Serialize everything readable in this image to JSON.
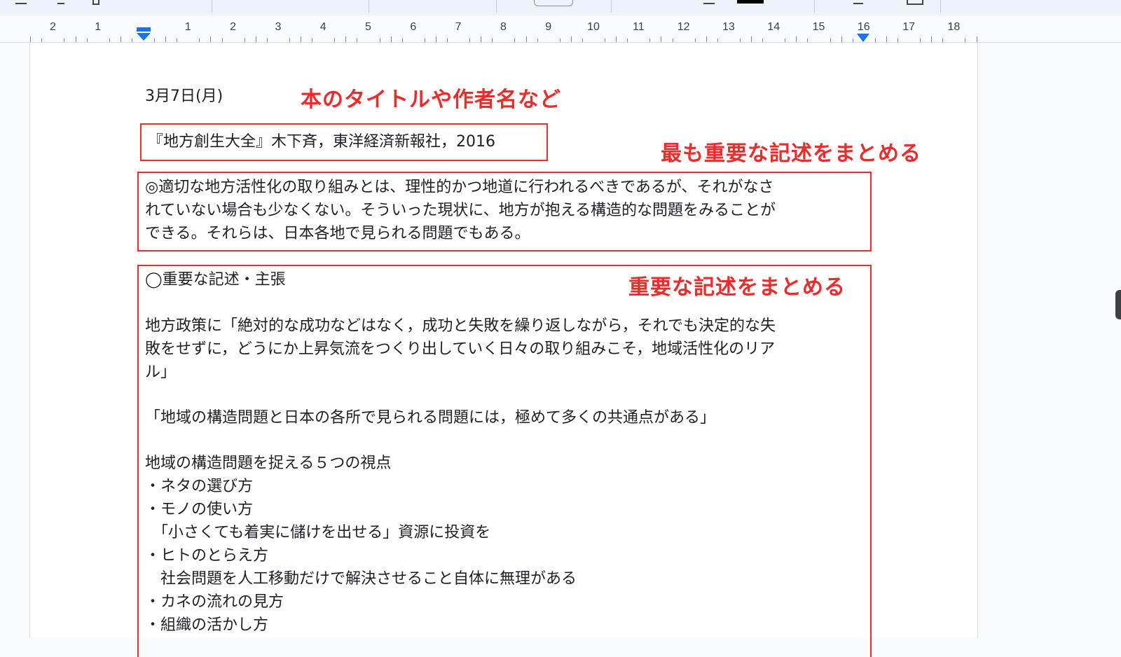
{
  "colors": {
    "annotation": "#ee2a2a",
    "indent_marker": "#1a73e8"
  },
  "ruler": {
    "numbers": [
      "2",
      "1",
      "1",
      "2",
      "3",
      "4",
      "5",
      "6",
      "7",
      "8",
      "9",
      "10",
      "11",
      "12",
      "13",
      "14",
      "15",
      "16",
      "17",
      "18"
    ],
    "icons": [
      "first-line-indent-icon",
      "right-indent-icon"
    ]
  },
  "document": {
    "date": "3月7日(月)",
    "citation": "『地方創生大全』木下斉，東洋経済新報社，2016",
    "summary_lines": [
      "◎適切な地方活性化の取り組みとは、理性的かつ地道に行われるべきであるが、それがなさ",
      "れていない場合も少なくない。そういった現状に、地方が抱える構造的な問題をみることが",
      "できる。それらは、日本各地で見られる問題でもある。"
    ],
    "section_heading": "◯重要な記述・主張",
    "quote1_lines": [
      "地方政策に「絶対的な成功などはなく，成功と失敗を繰り返しながら，それでも決定的な失",
      "敗をせずに，どうにか上昇気流をつくり出していく日々の取り組みこそ，地域活性化のリア",
      "ル」"
    ],
    "quote2": "「地域の構造問題と日本の各所で見られる問題には，極めて多くの共通点がある」",
    "viewpoints_title": "地域の構造問題を捉える５つの視点",
    "viewpoints": [
      "・ネタの選び方",
      "・モノの使い方",
      "　「小さくても着実に儲けを出せる」資源に投資を",
      "・ヒトのとらえ方",
      "　社会問題を人工移動だけで解決させること自体に無理がある",
      "・カネの流れの見方",
      "・組織の活かし方"
    ]
  },
  "annotations": {
    "title_note": "本のタイトルや作者名など",
    "summary_note": "最も重要な記述をまとめる",
    "important_note": "重要な記述をまとめる"
  }
}
